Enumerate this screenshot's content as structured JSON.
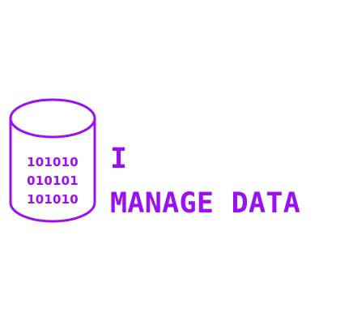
{
  "colors": {
    "accent": "#9b10f0",
    "background": "#ffffff"
  },
  "icon": "database-cylinder-icon",
  "database_text": [
    "101010",
    "010101",
    "101010"
  ],
  "headline": {
    "line1": "I",
    "line2": "MANAGE DATA"
  }
}
